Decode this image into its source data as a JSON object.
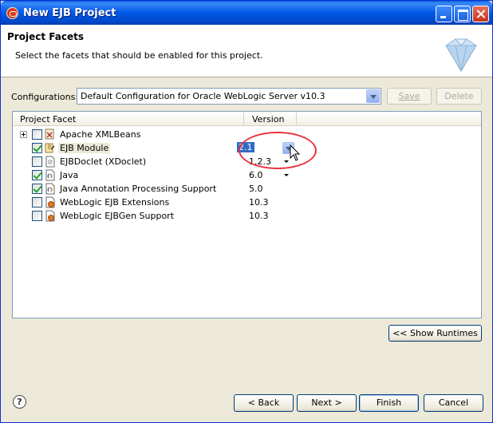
{
  "window": {
    "title": "New EJB Project"
  },
  "header": {
    "title": "Project Facets",
    "description": "Select the facets that should be enabled for this project."
  },
  "configurations": {
    "label": "Configurations:",
    "selected": "Default Configuration for Oracle WebLogic Server v10.3",
    "save_label": "Save",
    "delete_label": "Delete"
  },
  "table": {
    "columns": [
      "Project Facet",
      "Version"
    ],
    "rows": [
      {
        "label": "Apache XMLBeans",
        "version": "",
        "checked": false,
        "expandable": true
      },
      {
        "label": "EJB Module",
        "version": "2.1",
        "checked": true,
        "editing": true
      },
      {
        "label": "EJBDoclet (XDoclet)",
        "version": "1.2.3",
        "checked": false,
        "has_dropdown": true
      },
      {
        "label": "Java",
        "version": "6.0",
        "checked": true,
        "has_dropdown": true
      },
      {
        "label": "Java Annotation Processing Support",
        "version": "5.0",
        "checked": true
      },
      {
        "label": "WebLogic EJB Extensions",
        "version": "10.3",
        "checked": false
      },
      {
        "label": "WebLogic EJBGen Support",
        "version": "10.3",
        "checked": false
      }
    ]
  },
  "buttons": {
    "show_runtimes": "<< Show Runtimes",
    "back": "< Back",
    "next": "Next >",
    "finish": "Finish",
    "cancel": "Cancel",
    "help": "?"
  },
  "colors": {
    "title_bar": "#0058e6",
    "dialog_bg": "#ece9d8",
    "selection": "#316ac5",
    "annotation": "#e8323c"
  }
}
